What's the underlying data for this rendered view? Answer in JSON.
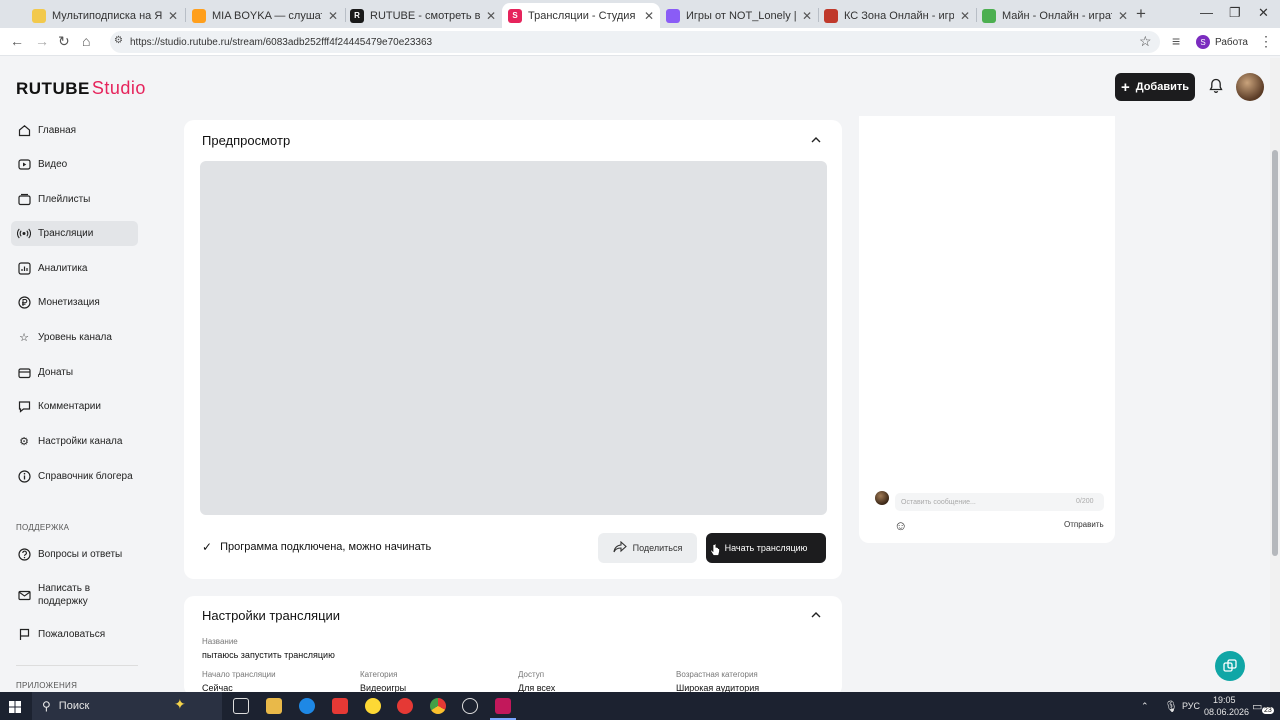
{
  "browser": {
    "tabs": [
      {
        "title": "Мультиподписка на Яндекс М",
        "favicon_color": "#f2c94c",
        "active": false
      },
      {
        "title": "MIA BOYKA — слушать онлайн",
        "favicon_color": "#ff9f1c",
        "active": false
      },
      {
        "title": "RUTUBE - смотреть видео онл",
        "favicon_color": "#1a1a1a",
        "active": false
      },
      {
        "title": "Трансляции - Студия RUTUBE",
        "favicon_color": "#e6245c",
        "active": true
      },
      {
        "title": "Игры от NOT_Lonely | Яндекс И",
        "favicon_color": "#8a5cf6",
        "active": false
      },
      {
        "title": "КС Зона Онлайн - играть онла",
        "favicon_color": "#c0392b",
        "active": false
      },
      {
        "title": "Майн - Онлайн - играть онлайн",
        "favicon_color": "#4caf50",
        "active": false
      }
    ],
    "url": "https://studio.rutube.ru/stream/6083adb252fff4f24445479e70e23363",
    "profile_label": "Работа",
    "profile_initial": "S"
  },
  "header": {
    "logo_main": "RUTUBE",
    "logo_studio": "Studio",
    "add_label": "Добавить"
  },
  "sidebar": {
    "items": [
      {
        "label": "Главная",
        "icon": "home-icon"
      },
      {
        "label": "Видео",
        "icon": "video-icon"
      },
      {
        "label": "Плейлисты",
        "icon": "playlist-icon"
      },
      {
        "label": "Трансляции",
        "icon": "broadcast-icon",
        "active": true
      },
      {
        "label": "Аналитика",
        "icon": "analytics-icon"
      },
      {
        "label": "Монетизация",
        "icon": "ruble-icon"
      },
      {
        "label": "Уровень канала",
        "icon": "star-icon"
      },
      {
        "label": "Донаты",
        "icon": "donate-icon"
      },
      {
        "label": "Комментарии",
        "icon": "comment-icon"
      },
      {
        "label": "Настройки канала",
        "icon": "gear-icon"
      },
      {
        "label": "Справочник блогера",
        "icon": "info-icon"
      }
    ],
    "support_heading": "ПОДДЕРЖКА",
    "support_items": [
      {
        "label": "Вопросы и ответы",
        "icon": "question-icon"
      },
      {
        "label": "Написать в поддержку",
        "icon": "mail-icon"
      },
      {
        "label": "Пожаловаться",
        "icon": "flag-icon"
      }
    ],
    "apps_heading": "ПРИЛОЖЕНИЯ"
  },
  "preview_card": {
    "title": "Предпросмотр",
    "status": "Программа подключена, можно начинать",
    "share_label": "Поделиться",
    "start_label": "Начать трансляцию"
  },
  "settings_card": {
    "title": "Настройки трансляции",
    "name_label": "Название",
    "name_value": "пытаюсь запустить трансляцию",
    "fields": [
      {
        "label": "Начало трансляции",
        "value": "Сейчас"
      },
      {
        "label": "Категория",
        "value": "Видеоигры"
      },
      {
        "label": "Доступ",
        "value": "Для всех"
      },
      {
        "label": "Возрастная категория",
        "value": "Широкая аудитория"
      }
    ]
  },
  "chat": {
    "placeholder": "Оставить сообщение...",
    "counter": "0/200",
    "send_label": "Отправить"
  },
  "taskbar": {
    "search_label": "Поиск",
    "lang": "РУС",
    "time": "19:05",
    "date": "08.06.2026",
    "notif_count": "23"
  }
}
